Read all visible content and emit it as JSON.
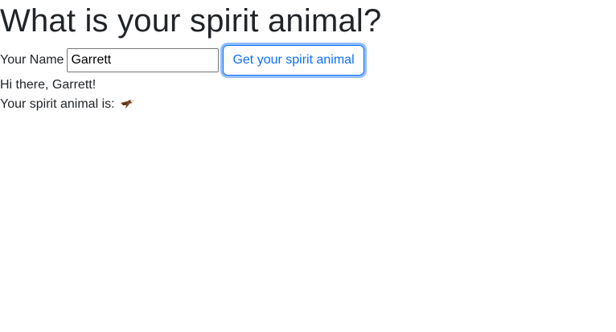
{
  "page": {
    "title": "What is your spirit animal?"
  },
  "form": {
    "name_label": "Your Name",
    "name_value": "Garrett",
    "button_label": "Get your spirit animal"
  },
  "result": {
    "greeting": "Hi there, Garrett!",
    "animal_label": "Your spirit animal is:",
    "animal_icon": "eagle-icon"
  },
  "colors": {
    "text": "#212529",
    "accent": "#0d6efd"
  }
}
